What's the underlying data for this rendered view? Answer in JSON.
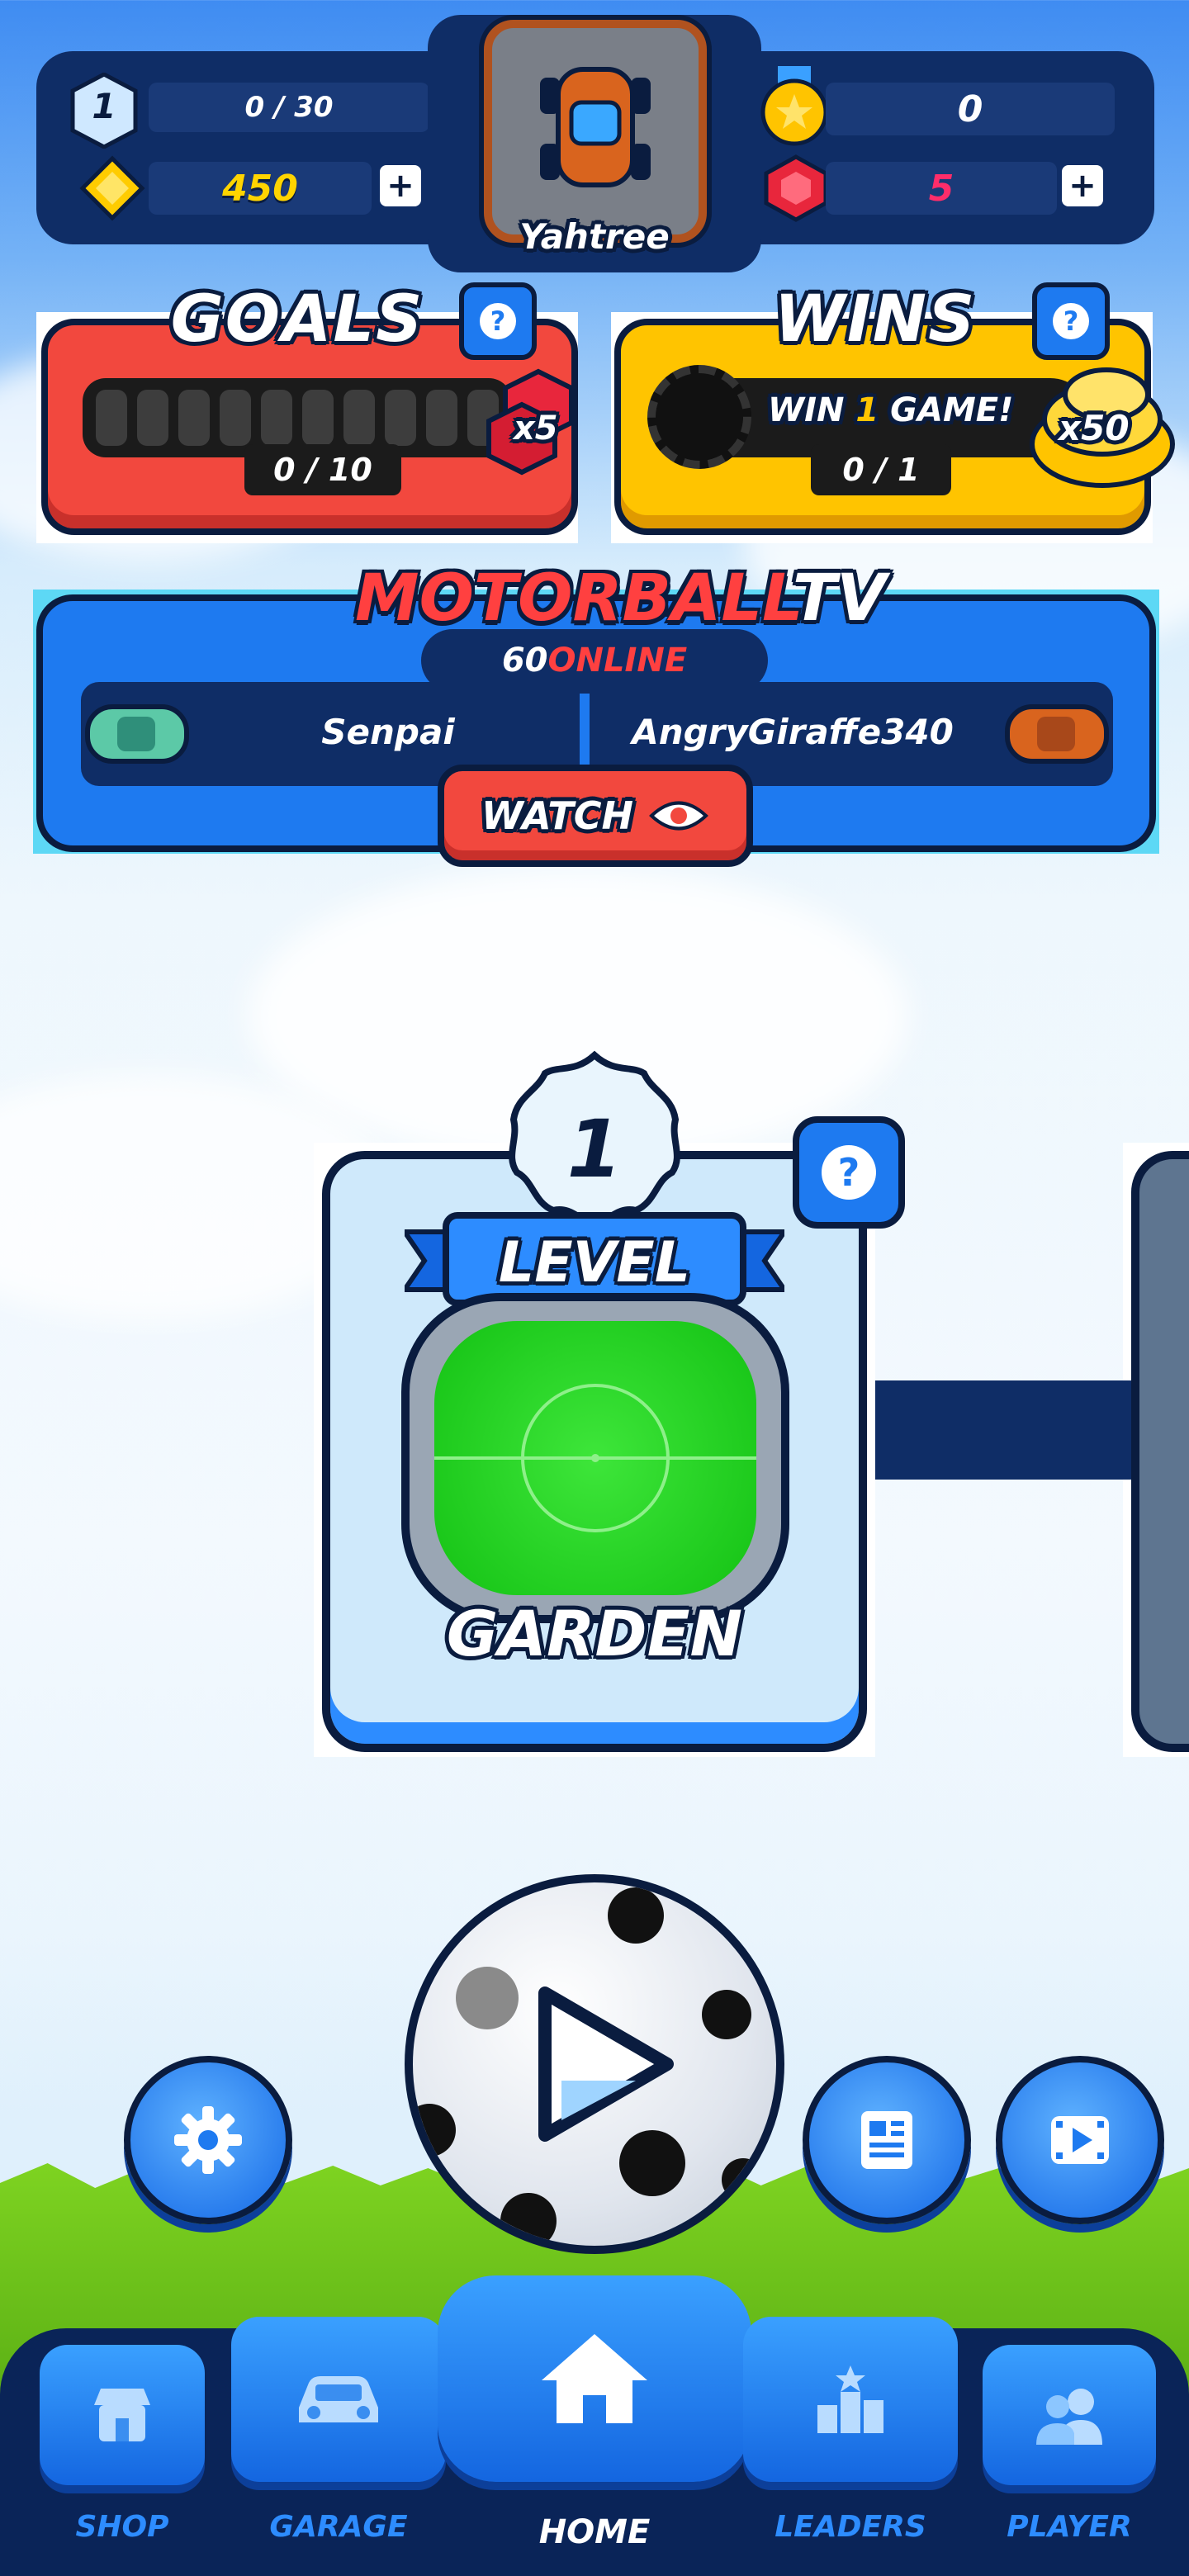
{
  "player": {
    "level": "1",
    "xp": "0 / 30",
    "coins": "450",
    "name": "Yahtree",
    "trophies": "0",
    "gems": "5"
  },
  "goals": {
    "title": "GOALS",
    "progress_text": "0 / 10",
    "progress": 0,
    "segments": 10,
    "reward": "x5"
  },
  "wins": {
    "title": "WINS",
    "prefix": "WIN ",
    "count": "1",
    "suffix": " GAME!",
    "progress_text": "0 / 1",
    "reward": "x50"
  },
  "tv": {
    "title_red": "MOTORBALL",
    "title_white": "TV",
    "online_count": "60",
    "online_label": " ONLINE",
    "player_left": "Senpai",
    "player_right": "AngryGiraffe340",
    "watch_label": "WATCH"
  },
  "level_card": {
    "number": "1",
    "label": "LEVEL",
    "name": "GARDEN"
  },
  "nav": {
    "shop": "SHOP",
    "garage": "GARAGE",
    "home": "HOME",
    "leaders": "LEADERS",
    "player": "PLAYER"
  },
  "colors": {
    "accent_blue": "#1e7af0",
    "goals_red": "#f2483e",
    "wins_yellow": "#ffc400",
    "dark_navy": "#0a1c3f",
    "tv_red": "#ff4040"
  },
  "icons": [
    "level-badge-icon",
    "coin-icon",
    "trophy-medal-icon",
    "gem-icon",
    "plus-icon",
    "help-icon",
    "eye-icon",
    "gear-icon",
    "news-icon",
    "video-icon",
    "play-icon",
    "shop-icon",
    "car-icon",
    "home-icon",
    "leaders-icon",
    "player-icon"
  ]
}
